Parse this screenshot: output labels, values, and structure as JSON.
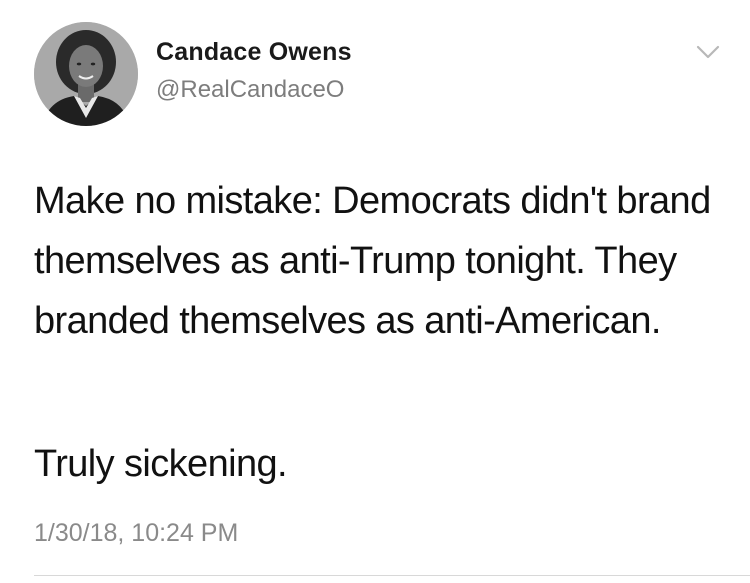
{
  "tweet": {
    "author": {
      "display_name": "Candace Owens",
      "handle": "@RealCandaceO",
      "avatar_icon": "profile-photo"
    },
    "menu_icon": "chevron-down-icon",
    "text_paragraphs": [
      "Make no mistake: Democrats didn't brand themselves as anti-Trump tonight. They branded themselves as anti-American.",
      "Truly sickening."
    ],
    "timestamp": "1/30/18, 10:24 PM"
  },
  "colors": {
    "name": "#1a1a1a",
    "handle": "#7d7d7d",
    "text": "#111111",
    "timestamp": "#8a8a8a",
    "divider": "#d8d8d8"
  }
}
